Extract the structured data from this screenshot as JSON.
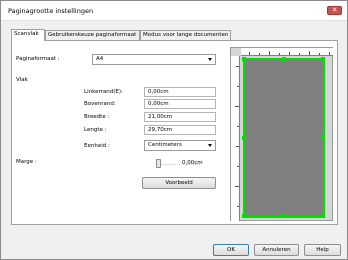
{
  "window": {
    "title": "Paginagrootte instellingen",
    "close_glyph": "✕"
  },
  "tabs": [
    {
      "label": "Scanvlak",
      "active": true
    },
    {
      "label": "Gebruikerskeuze paginaformaat",
      "active": false
    },
    {
      "label": "Modus voor lange documenten",
      "active": false
    }
  ],
  "form": {
    "paper_size_label": "Paginaformaat :",
    "paper_size_value": "A4",
    "area_label": "Vlak",
    "left_label": "Linkerrand(E):",
    "left_value": "0,00cm",
    "top_label": "Bovenrand:",
    "top_value": "0,00cm",
    "width_label": "Breedte :",
    "width_value": "21,00cm",
    "length_label": "Lengte :",
    "length_value": "29,70cm",
    "unit_label": "Eenheid :",
    "unit_value": "Centimeters",
    "margin_label": "Marge :",
    "margin_value": "0,00cm",
    "preview_button": "Voorbeeld"
  },
  "footer": {
    "ok": "OK",
    "cancel": "Annuleren",
    "help": "Help"
  },
  "colors": {
    "frame": "#00e000",
    "page": "#808080"
  }
}
